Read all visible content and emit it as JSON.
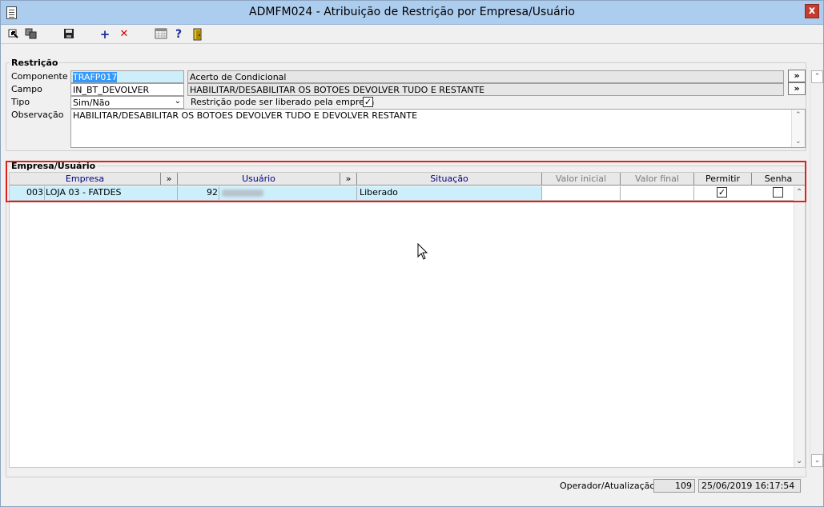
{
  "window": {
    "title": "ADMFM024 - Atribuição de Restrição por Empresa/Usuário",
    "close": "x"
  },
  "toolbar": {
    "new": "+",
    "delete": "✕",
    "help": "?"
  },
  "restricao": {
    "group_title": "Restrição",
    "componente": {
      "label": "Componente",
      "value": "TRAFP017",
      "desc": "Acerto de Condicional",
      "btn": "»"
    },
    "campo": {
      "label": "Campo",
      "value": "IN_BT_DEVOLVER",
      "desc": "HABILITAR/DESABILITAR OS BOTOES DEVOLVER TUDO E RESTANTE",
      "btn": "»"
    },
    "tipo": {
      "label": "Tipo",
      "value": "Sim/Não",
      "check_label": "Restrição pode ser liberado pela empresa",
      "checked": true
    },
    "observacao": {
      "label": "Observação",
      "value": "HABILITAR/DESABILITAR OS BOTOES DEVOLVER TUDO E DEVOLVER RESTANTE"
    }
  },
  "empresa_usuario": {
    "group_title": "Empresa/Usuário",
    "columns": {
      "empresa": "Empresa",
      "usuario": "Usuário",
      "situacao": "Situação",
      "valor_inicial": "Valor inicial",
      "valor_final": "Valor final",
      "permitir": "Permitir",
      "senha": "Senha",
      "expand": "»"
    },
    "rows": [
      {
        "empresa_code": "003",
        "empresa_name": "LOJA 03 - FATDES",
        "usuario_code": "92",
        "situacao": "Liberado",
        "valor_inicial": "",
        "valor_final": "",
        "permitir": true,
        "senha": false
      }
    ]
  },
  "status": {
    "label": "Operador/Atualização",
    "operador": "109",
    "atualizacao": "25/06/2019 16:17:54"
  },
  "colors": {
    "titlebar": "#adcdef",
    "selected_row": "#cdeffb",
    "highlight_border": "#e02020",
    "header_text": "#000080"
  }
}
